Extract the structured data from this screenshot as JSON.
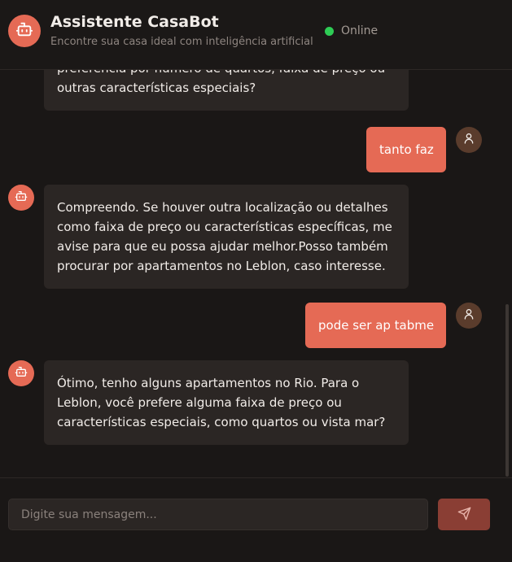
{
  "header": {
    "title": "Assistente CasaBot",
    "subtitle": "Encontre sua casa ideal com inteligência artificial",
    "status": "Online",
    "avatar_icon": "robot-icon",
    "status_color": "#2ecc55"
  },
  "messages": [
    {
      "sender": "bot",
      "lines": [
        "preferência por número de quartos, faixa de preço ou",
        "outras características especiais?"
      ]
    },
    {
      "sender": "user",
      "text": "tanto faz"
    },
    {
      "sender": "bot",
      "lines": [
        "Compreendo. Se houver outra localização ou detalhes",
        "como faixa de preço ou características específicas, me",
        "avise para que eu possa ajudar melhor.Posso também",
        "procurar por apartamentos no Leblon, caso interesse."
      ]
    },
    {
      "sender": "user",
      "text": "pode ser ap tabme"
    },
    {
      "sender": "bot",
      "lines": [
        "Ótimo, tenho alguns apartamentos no Rio. Para o",
        "Leblon, você prefere alguma faixa de preço ou",
        "características especiais, como quartos ou vista mar?"
      ]
    }
  ],
  "composer": {
    "placeholder": "Digite sua mensagem...",
    "value": "",
    "send_icon": "send-icon"
  },
  "colors": {
    "accent": "#e56a55",
    "background": "#1a1716",
    "bot_bubble": "#2b2624",
    "send_button_disabled": "#8a3e34"
  }
}
